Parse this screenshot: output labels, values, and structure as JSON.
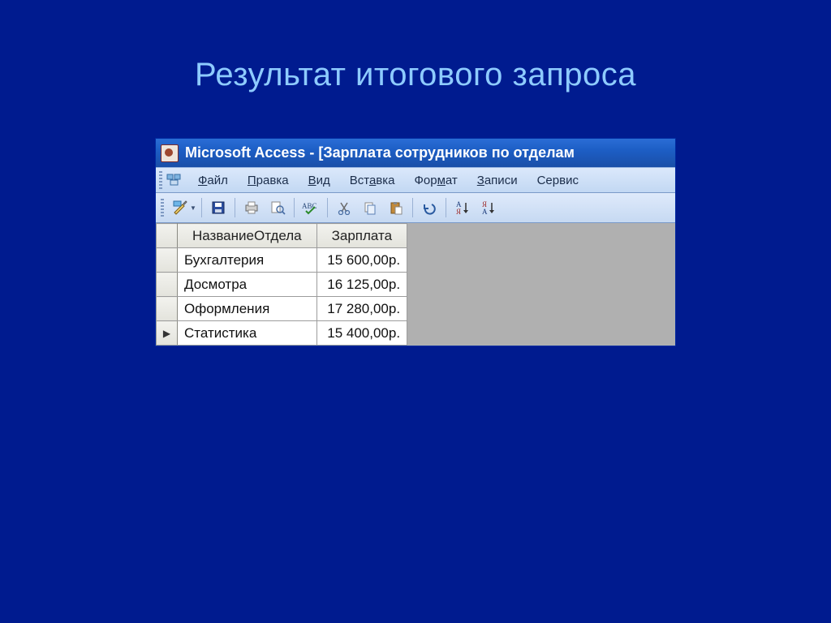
{
  "slide": {
    "title": "Результат итогового запроса"
  },
  "window": {
    "title": "Microsoft Access - [Зарплата сотрудников по отделам"
  },
  "menu": {
    "items": [
      {
        "label": "Файл",
        "u": 0
      },
      {
        "label": "Правка",
        "u": 0
      },
      {
        "label": "Вид",
        "u": 0
      },
      {
        "label": "Вставка",
        "u": 3
      },
      {
        "label": "Формат",
        "u": 3
      },
      {
        "label": "Записи",
        "u": 0
      },
      {
        "label": "Сервис",
        "u": -1
      }
    ]
  },
  "toolbar": {
    "icons": [
      "design-view",
      "dd",
      "sep",
      "save",
      "sep",
      "print",
      "print-preview",
      "sep",
      "spelling",
      "sep",
      "cut",
      "copy",
      "paste",
      "sep",
      "undo",
      "sep",
      "sort-asc",
      "sort-desc"
    ]
  },
  "table": {
    "headers": [
      "НазваниеОтдела",
      "Зарплата"
    ],
    "rows": [
      {
        "dept": "Бухгалтерия",
        "salary": "15 600,00р."
      },
      {
        "dept": "Досмотра",
        "salary": "16 125,00р."
      },
      {
        "dept": "Оформления",
        "salary": "17 280,00р."
      },
      {
        "dept": "Статистика",
        "salary": "15 400,00р."
      }
    ],
    "current_row_index": 3,
    "current_marker": "▶"
  }
}
